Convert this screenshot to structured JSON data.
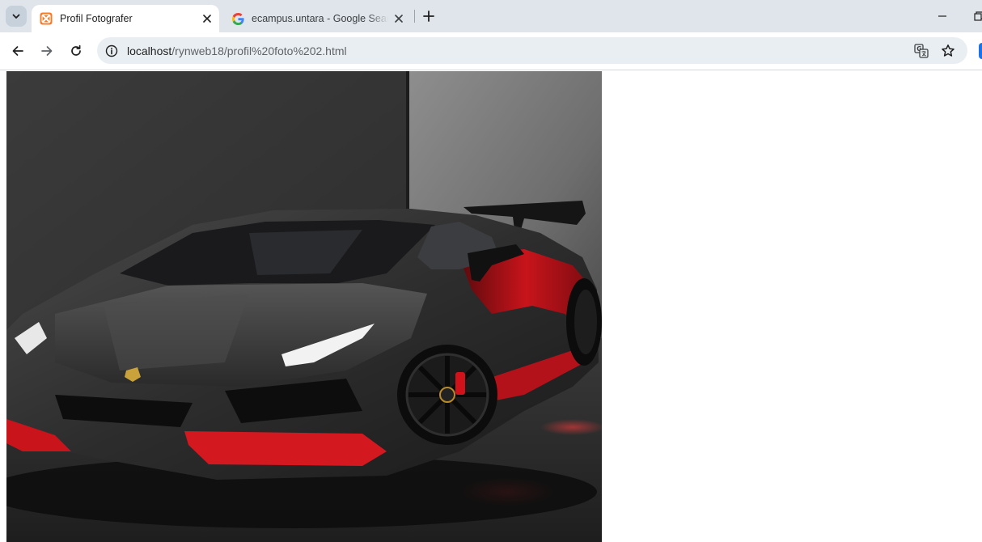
{
  "tabs": [
    {
      "title": "Profil Fotografer",
      "active": true,
      "favicon": "xampp-icon"
    },
    {
      "title": "ecampus.untara - Google Search",
      "active": false,
      "favicon": "google-icon"
    }
  ],
  "address_bar": {
    "host": "localhost",
    "path": "/rynweb18/profil%20foto%202.html"
  },
  "page": {
    "image_alt": "Black and red Lamborghini sports car in a concrete studio"
  },
  "colors": {
    "tabstrip_bg": "#dfe5eb",
    "omnibox_bg": "#e9eef2",
    "car_accent": "#d8141c"
  }
}
